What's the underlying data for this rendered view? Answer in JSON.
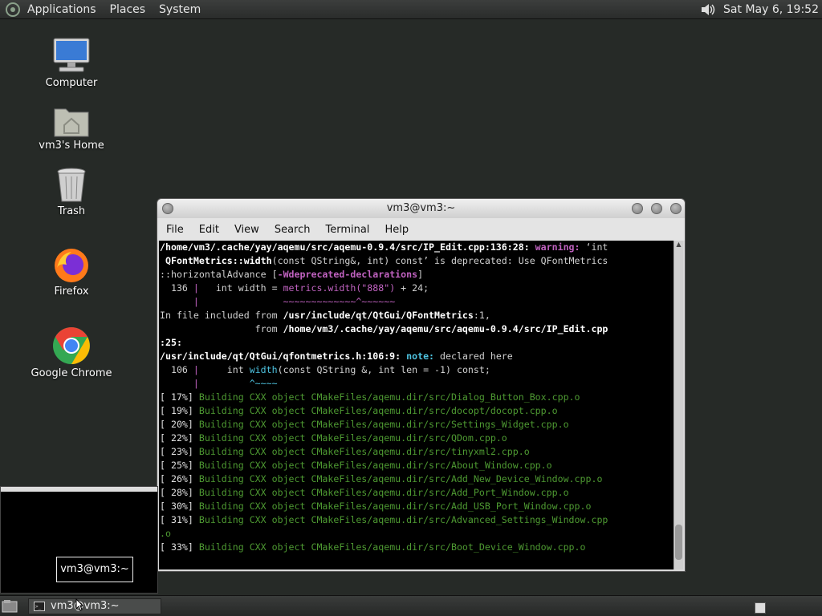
{
  "top_panel": {
    "menus": [
      "Applications",
      "Places",
      "System"
    ],
    "clock": "Sat May  6, 19:52"
  },
  "desktop_icons": [
    {
      "label": "Computer",
      "icon": "computer-icon"
    },
    {
      "label": "vm3's Home",
      "icon": "home-folder-icon"
    },
    {
      "label": "Trash",
      "icon": "trash-icon"
    },
    {
      "label": "Firefox",
      "icon": "firefox-icon"
    },
    {
      "label": "Google Chrome",
      "icon": "chrome-icon"
    }
  ],
  "terminal": {
    "title": "vm3@vm3:~",
    "menus": [
      "File",
      "Edit",
      "View",
      "Search",
      "Terminal",
      "Help"
    ],
    "lines": [
      "/home/vm3/.cache/yay/aqemu/src/aqemu-0.9.4/src/IP_Edit.cpp:136:28: warning: ‘int",
      " QFontMetrics::width(const QString&, int) const’ is deprecated: Use QFontMetrics",
      "::horizontalAdvance [-Wdeprecated-declarations]",
      "  136 |   int width = metrics.width(\"888\") + 24;",
      "      |               ~~~~~~~~~~~~~^~~~~~~",
      "In file included from /usr/include/qt/QtGui/QFontMetrics:1,",
      "                 from /home/vm3/.cache/yay/aqemu/src/aqemu-0.9.4/src/IP_Edit.cpp",
      ":25:",
      "/usr/include/qt/QtGui/qfontmetrics.h:106:9: note: declared here",
      "  106 |     int width(const QString &, int len = -1) const;",
      "      |         ^~~~~",
      "[ 17%] Building CXX object CMakeFiles/aqemu.dir/src/Dialog_Button_Box.cpp.o",
      "[ 19%] Building CXX object CMakeFiles/aqemu.dir/src/docopt/docopt.cpp.o",
      "[ 20%] Building CXX object CMakeFiles/aqemu.dir/src/Settings_Widget.cpp.o",
      "[ 22%] Building CXX object CMakeFiles/aqemu.dir/src/QDom.cpp.o",
      "[ 23%] Building CXX object CMakeFiles/aqemu.dir/src/tinyxml2.cpp.o",
      "[ 25%] Building CXX object CMakeFiles/aqemu.dir/src/About_Window.cpp.o",
      "[ 26%] Building CXX object CMakeFiles/aqemu.dir/src/Add_New_Device_Window.cpp.o",
      "[ 28%] Building CXX object CMakeFiles/aqemu.dir/src/Add_Port_Window.cpp.o",
      "[ 30%] Building CXX object CMakeFiles/aqemu.dir/src/Add_USB_Port_Window.cpp.o",
      "[ 31%] Building CXX object CMakeFiles/aqemu.dir/src/Advanced_Settings_Window.cpp",
      ".o",
      "[ 33%] Building CXX object CMakeFiles/aqemu.dir/src/Boot_Device_Window.cpp.o"
    ]
  },
  "tooltip": "vm3@vm3:~",
  "taskbar": {
    "window_button": "vm3@vm3:~"
  }
}
